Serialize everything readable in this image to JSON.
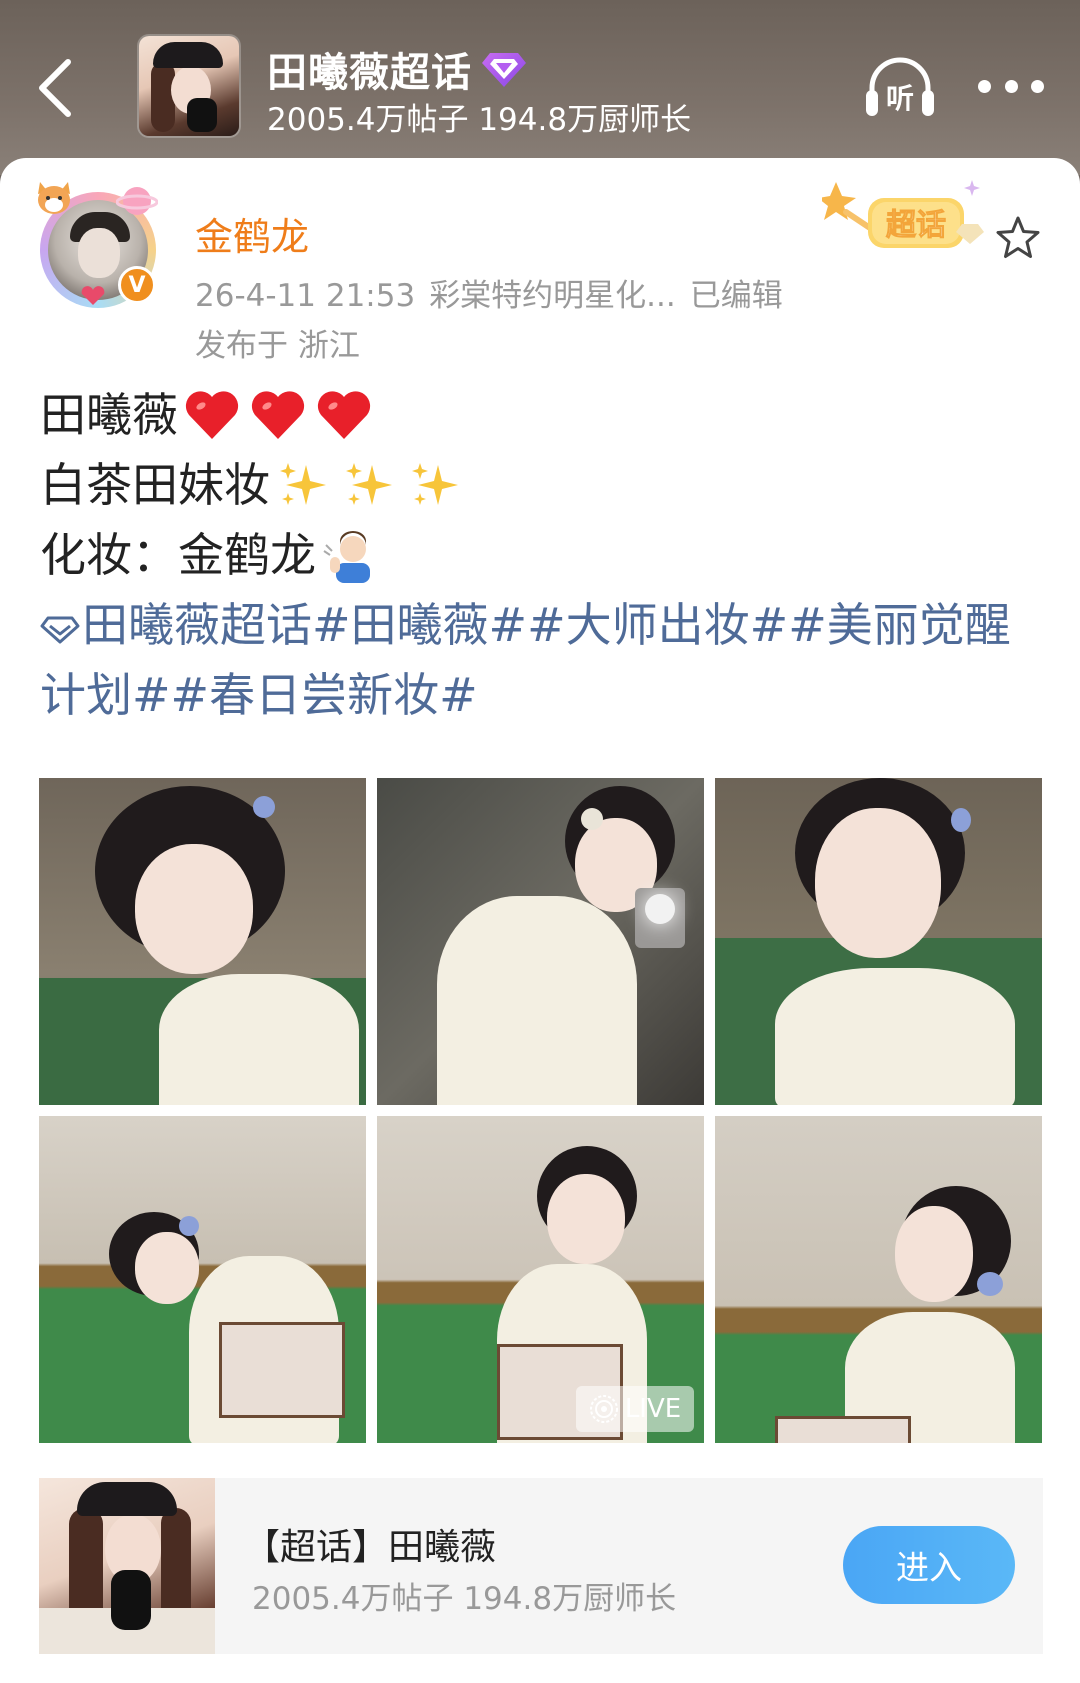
{
  "header": {
    "title": "田曦薇超话",
    "stats": "2005.4万帖子 194.8万厨师长",
    "listen_label": "听"
  },
  "post": {
    "author": "金鹤龙",
    "verified_mark": "V",
    "timestamp": "26-4-11 21:53",
    "source": "彩棠特约明星化...",
    "edited": "已编辑",
    "location": "发布于 浙江",
    "badge_text": "超话",
    "content": {
      "line1": "田曦薇",
      "line2": "白茶田妹妆",
      "line3": "化妆：金鹤龙",
      "topics": [
        "田曦薇超话",
        "#田曦薇#",
        "#大师出妆#",
        "#美丽觉醒计划#",
        "#春日尝新妆#"
      ]
    },
    "live_label": "LIVE"
  },
  "topic_card": {
    "title": "【超话】田曦薇",
    "stats": "2005.4万帖子 194.8万厨师长",
    "enter_label": "进入"
  },
  "colors": {
    "author_orange": "#ef7d1a",
    "topic_blue": "#4f6b98",
    "meta_gray": "#999999",
    "enter_blue": "#4aa6f5"
  },
  "icons": {
    "back": "chevron-left-icon",
    "diamond": "diamond-badge-icon",
    "listen": "headphones-icon",
    "more": "more-dots-icon",
    "star": "star-outline-icon",
    "heart": "red-heart-emoji",
    "sparkles": "sparkles-emoji",
    "person": "man-tipping-hand-emoji",
    "live": "live-photo-icon"
  }
}
